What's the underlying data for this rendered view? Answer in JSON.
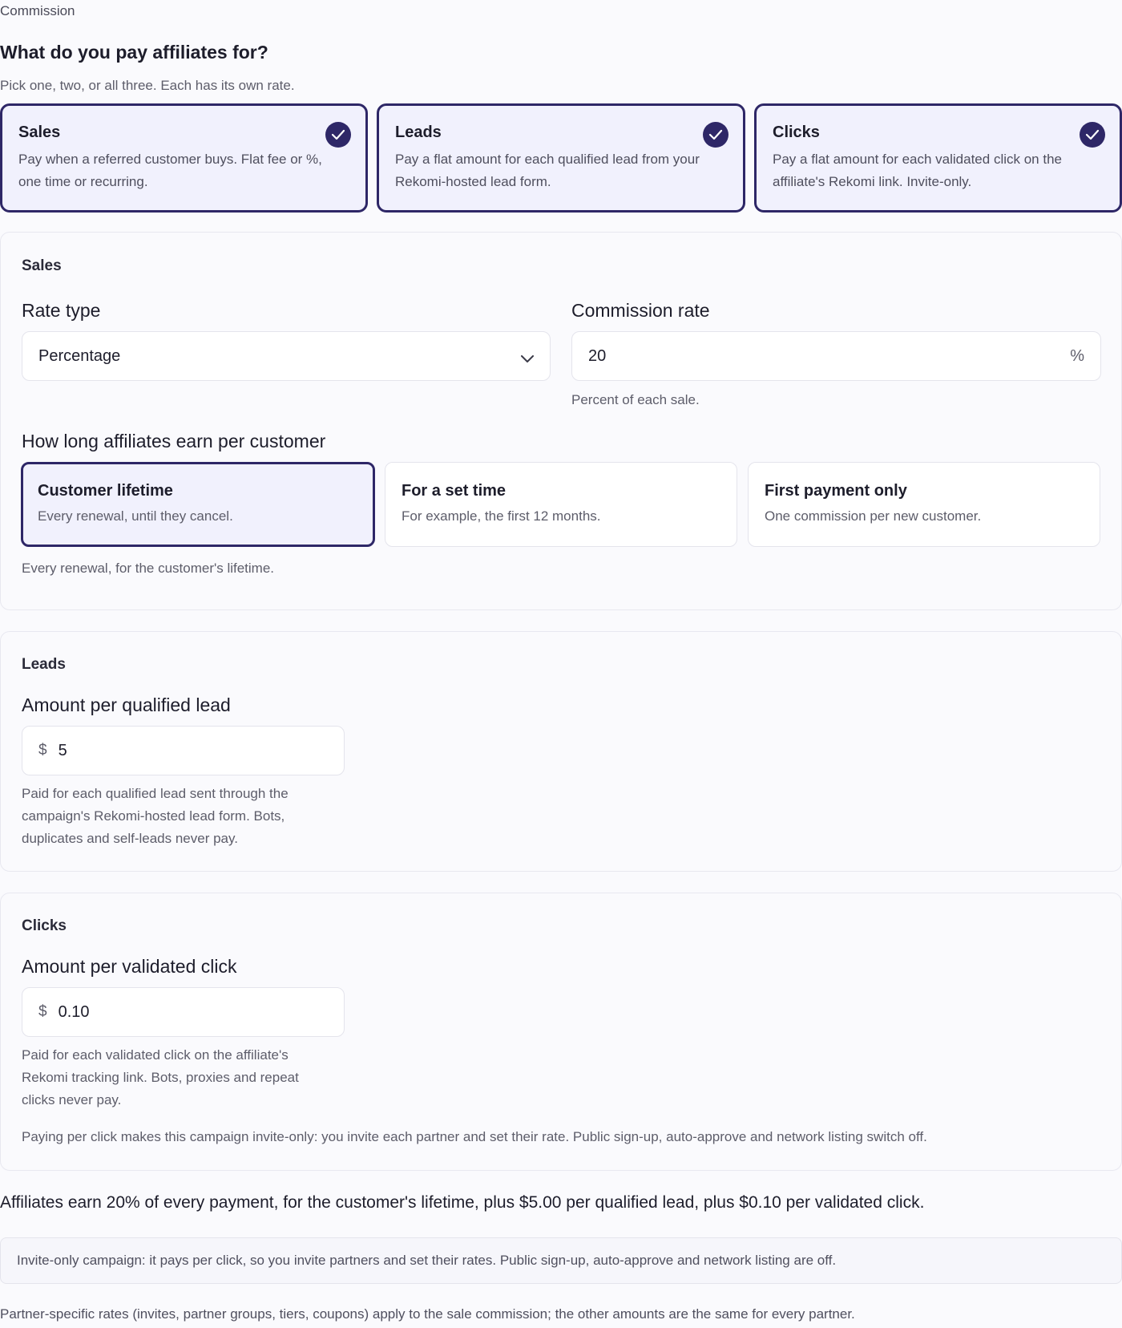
{
  "section_label": "Commission",
  "heading": "What do you pay affiliates for?",
  "subheading": "Pick one, two, or all three. Each has its own rate.",
  "types": [
    {
      "title": "Sales",
      "desc": "Pay when a referred customer buys. Flat fee or %, one time or recurring.",
      "checked": true
    },
    {
      "title": "Leads",
      "desc": "Pay a flat amount for each qualified lead from your Rekomi-hosted lead form.",
      "checked": true
    },
    {
      "title": "Clicks",
      "desc": "Pay a flat amount for each validated click on the affiliate's Rekomi link. Invite-only.",
      "checked": true
    }
  ],
  "sales": {
    "title": "Sales",
    "rate_type_label": "Rate type",
    "rate_type_value": "Percentage",
    "commission_rate_label": "Commission rate",
    "commission_rate_value": "20",
    "commission_rate_suffix": "%",
    "commission_rate_help": "Percent of each sale.",
    "duration_label": "How long affiliates earn per customer",
    "durations": [
      {
        "title": "Customer lifetime",
        "desc": "Every renewal, until they cancel.",
        "selected": true
      },
      {
        "title": "For a set time",
        "desc": "For example, the first 12 months.",
        "selected": false
      },
      {
        "title": "First payment only",
        "desc": "One commission per new customer.",
        "selected": false
      }
    ],
    "duration_help": "Every renewal, for the customer's lifetime."
  },
  "leads": {
    "title": "Leads",
    "amount_label": "Amount per qualified lead",
    "prefix": "$",
    "amount_value": "5",
    "help": "Paid for each qualified lead sent through the campaign's Rekomi-hosted lead form. Bots, duplicates and self-leads never pay."
  },
  "clicks": {
    "title": "Clicks",
    "amount_label": "Amount per validated click",
    "prefix": "$",
    "amount_value": "0.10",
    "help": "Paid for each validated click on the affiliate's Rekomi tracking link. Bots, proxies and repeat clicks never pay.",
    "invite_note": "Paying per click makes this campaign invite-only: you invite each partner and set their rate. Public sign-up, auto-approve and network listing switch off."
  },
  "summary": "Affiliates earn 20% of every payment, for the customer's lifetime, plus $5.00 per qualified lead, plus $0.10 per validated click.",
  "notice": "Invite-only campaign: it pays per click, so you invite partners and set their rates. Public sign-up, auto-approve and network listing are off.",
  "footnote": "Partner-specific rates (invites, partner groups, tiers, coupons) apply to the sale commission; the other amounts are the same for every partner.",
  "colors": {
    "accent": "#2e2767",
    "selected_bg": "#f1f1fd"
  }
}
